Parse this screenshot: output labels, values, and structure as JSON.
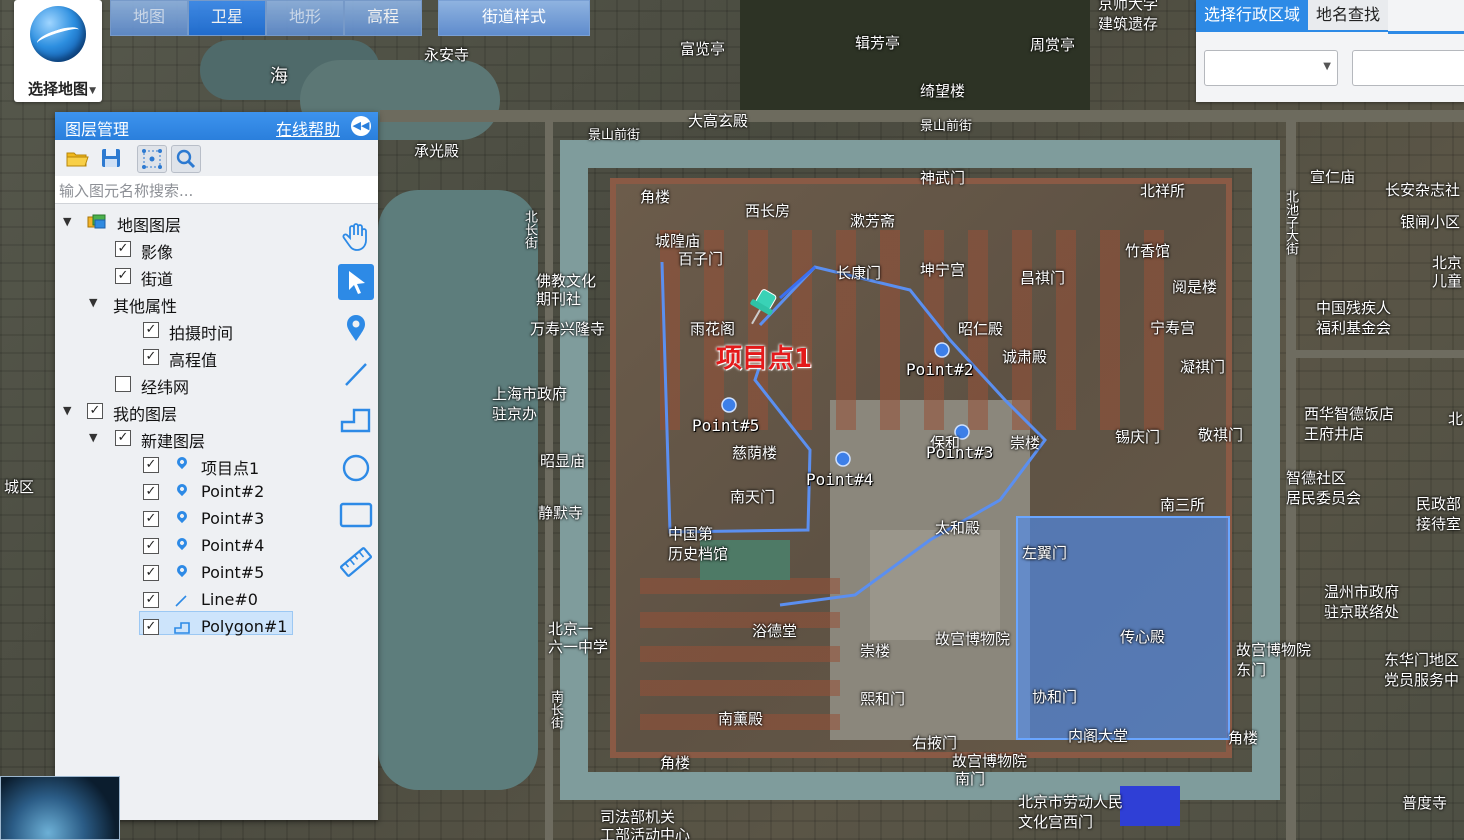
{
  "map_type": {
    "selector_label": "选择地图",
    "tabs": [
      {
        "label": "地图",
        "state": "dim"
      },
      {
        "label": "卫星",
        "state": "active"
      },
      {
        "label": "地形",
        "state": "dim"
      },
      {
        "label": "高程",
        "state": "normal"
      }
    ],
    "street_style_label": "街道样式"
  },
  "search_panel": {
    "tabs": [
      {
        "label": "选择行政区域",
        "active": true
      },
      {
        "label": "地名查找",
        "active": false
      }
    ],
    "region_select_value": "",
    "place_input_value": ""
  },
  "layer_panel": {
    "title": "图层管理",
    "help_link": "在线帮助",
    "toolbar_icons": [
      "open-folder-icon",
      "save-icon",
      "select-tool-icon",
      "search-icon"
    ],
    "search_placeholder": "输入图元名称搜索...",
    "tree": {
      "map_layers": {
        "label": "地图图层",
        "expanded": true
      },
      "imagery": {
        "label": "影像",
        "checked": true
      },
      "streets": {
        "label": "街道",
        "checked": true
      },
      "other_props": {
        "label": "其他属性",
        "expanded": true
      },
      "capture_time": {
        "label": "拍摄时间",
        "checked": true
      },
      "elevation": {
        "label": "高程值",
        "checked": true
      },
      "graticule": {
        "label": "经纬网",
        "checked": false
      },
      "my_layers": {
        "label": "我的图层",
        "checked": true,
        "expanded": true
      },
      "new_layer": {
        "label": "新建图层",
        "checked": true,
        "expanded": true
      },
      "features": [
        {
          "label": "项目点1",
          "type": "point",
          "checked": true
        },
        {
          "label": "Point#2",
          "type": "point",
          "checked": true
        },
        {
          "label": "Point#3",
          "type": "point",
          "checked": true
        },
        {
          "label": "Point#4",
          "type": "point",
          "checked": true
        },
        {
          "label": "Point#5",
          "type": "point",
          "checked": true
        },
        {
          "label": "Line#0",
          "type": "line",
          "checked": true
        },
        {
          "label": "Polygon#1",
          "type": "polygon",
          "checked": true,
          "selected": true
        }
      ]
    },
    "draw_tools": [
      "hand-icon",
      "arrow-select-icon",
      "marker-icon",
      "line-icon",
      "polyline-icon",
      "circle-icon",
      "rectangle-icon",
      "ruler-icon"
    ],
    "active_tool": "arrow-select-icon"
  },
  "map": {
    "feature_labels": {
      "project_point": "项目点1",
      "point2": "Point#2",
      "point3": "Point#3",
      "point4": "Point#4",
      "point5": "Point#5"
    },
    "line_color": "#5b8ff0",
    "polygon_color": "#4d8ef5",
    "place_names": {
      "fuyou": "富览亭",
      "jifang": "辑芳亭",
      "zhoushang": "周赏亭",
      "qiwang": "绮望楼",
      "yongan": "永安寺",
      "hai": "海",
      "dagaoxuan": "大高玄殿",
      "jingshan1": "景山前街",
      "jingshan2": "景山前街",
      "chengguang": "承光殿",
      "shenwu": "神武门",
      "jiaolou1": "角楼",
      "xichangfang": "西长房",
      "shufang": "漱芳斋",
      "chenghuang": "城隍庙",
      "baizi": "百子门",
      "changkang": "长康门",
      "kunning": "坤宁宫",
      "changqi": "昌祺门",
      "zhuxiang": "竹香馆",
      "yueshi": "阅是楼",
      "ningshou": "宁寿宫",
      "zhaoren": "昭仁殿",
      "yusu": "诚肃殿",
      "ningqi": "凝祺门",
      "yuhua": "雨花阁",
      "fojiao": "佛教文化\n期刊社",
      "wanshou": "万寿兴隆寺",
      "shanghai": "上海市政府\n驻京办",
      "zhaoxian": "昭显庙",
      "jingmo": "静默寺",
      "cining": "慈荫楼",
      "nantian": "南天门",
      "baohe": "保和",
      "chonglou1": "崇楼",
      "xiqing": "锡庆门",
      "jingqi": "敬祺门",
      "nansan": "南三所",
      "taihe": "太和殿",
      "zhongguo_dangan": "中国第\n历史档馆",
      "zuoyi": "左翼门",
      "chuanxin": "传心殿",
      "xiehe": "协和门",
      "neige": "内阁大堂",
      "jiaolou2": "角楼",
      "yude": "浴德堂",
      "chonglou2": "崇楼",
      "gugong1": "故宫博物院",
      "gugong2": "故宫博物院\n东门",
      "xihe": "熙和门",
      "nanxun": "南薰殿",
      "youyi": "右掖门",
      "gugong3": "故宫博物院",
      "wumen": "南门",
      "jiaolou3": "角楼",
      "beijing_yi": "北京一\n六一中学",
      "sifabu": "司法部机关\n工部活动中心",
      "laodong": "北京市劳动人民\n文化宫西门",
      "beichang": "北长街",
      "nanchang": "南长街",
      "beichizi": "北池子大街",
      "xuanren": "宣仁庙",
      "changan": "长安杂志社",
      "yinzha": "银闸小区",
      "beijing_er": "北京\n儿童",
      "canji": "中国残疾人\n福利基金会",
      "xihua": "西华智德饭店\n王府井店",
      "zhihui": "智德社区\n居民委员会",
      "wenzhou": "温州市政府\n驻京联络处",
      "minzheng": "民政部\n接待室",
      "donghua": "东华门地区\n党员服务中",
      "puquan": "普度寺",
      "jingbian": "京师大学\n建筑遗存",
      "lou": "城区",
      "beixiang": "北祥所",
      "bei": "北"
    }
  }
}
